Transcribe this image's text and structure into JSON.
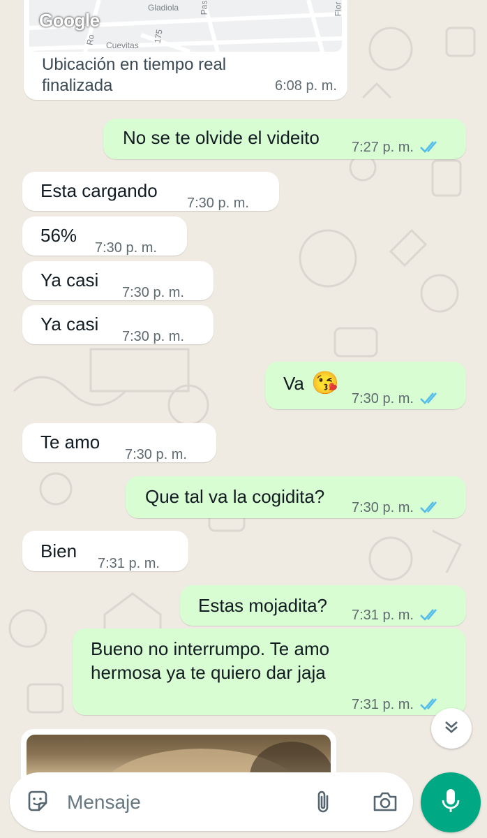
{
  "colors": {
    "background": "#efeae2",
    "incoming": "#ffffff",
    "outgoing": "#d9fdd3",
    "read_ticks": "#53bdeb",
    "mic_button": "#00a884",
    "meta_text": "#5e6a70"
  },
  "location_card": {
    "map_labels": [
      "Gladiola",
      "Cuevitas",
      "175",
      "Flor",
      "Ro",
      "Pas"
    ],
    "logo": "Google",
    "text_line1": "Ubicación en tiempo real",
    "text_line2": "finalizada",
    "time": "6:08 p. m."
  },
  "messages": [
    {
      "direction": "out",
      "text": "No se te olvide el videito",
      "time": "7:27 p. m.",
      "status": "read"
    },
    {
      "direction": "in",
      "text": "Esta cargando",
      "time": "7:30 p. m."
    },
    {
      "direction": "in",
      "text": "56%",
      "time": "7:30 p. m."
    },
    {
      "direction": "in",
      "text": "Ya casi",
      "time": "7:30 p. m."
    },
    {
      "direction": "in",
      "text": "Ya casi",
      "time": "7:30 p. m."
    },
    {
      "direction": "out",
      "text": "Va",
      "emoji": "😘",
      "time": "7:30 p. m.",
      "status": "read"
    },
    {
      "direction": "in",
      "text": "Te amo",
      "time": "7:30 p. m."
    },
    {
      "direction": "out",
      "text": "Que tal va la cogidita?",
      "time": "7:30 p. m.",
      "status": "read"
    },
    {
      "direction": "in",
      "text": "Bien",
      "time": "7:31 p. m."
    },
    {
      "direction": "out",
      "text": "Estas mojadita?",
      "time": "7:31 p. m.",
      "status": "read"
    },
    {
      "direction": "out",
      "text_line1": "Bueno no interrumpo. Te amo",
      "text_line2": "hermosa ya te quiero dar jaja",
      "time": "7:31 p. m.",
      "status": "read"
    }
  ],
  "scroll_down": {
    "icon": "double-chevron-down-icon"
  },
  "media_message": {
    "direction": "in",
    "kind": "image"
  },
  "input_bar": {
    "placeholder": "Mensaje",
    "icons": [
      "sticker-icon",
      "paperclip-icon",
      "camera-icon"
    ],
    "mic_icon": "microphone-icon"
  }
}
